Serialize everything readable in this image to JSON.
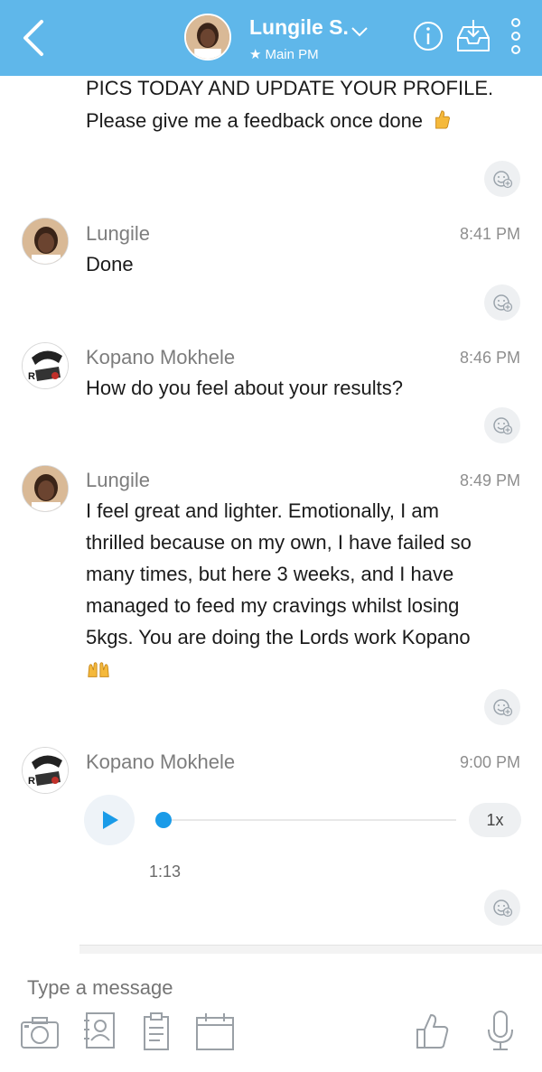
{
  "header": {
    "contact_name": "Lungile S.",
    "subtitle": "Main PM",
    "background_color": "#5fb7ea",
    "icons": [
      "back-arrow-icon",
      "chevron-down-icon",
      "info-icon",
      "inbox-download-icon",
      "more-vertical-icon"
    ]
  },
  "conversation": {
    "top_message_lines": [
      "PICS TODAY AND UPDATE YOUR PROFILE.",
      "Please give me a feedback once done"
    ],
    "messages": [
      {
        "sender": "Lungile",
        "time": "8:41 PM",
        "lines": [
          "Done"
        ]
      },
      {
        "sender": "Kopano Mokhele",
        "time": "8:46 PM",
        "lines": [
          "How do you feel about your results?"
        ]
      },
      {
        "sender": "Lungile",
        "time": "8:49 PM",
        "lines": [
          "I feel great and lighter. Emotionally, I am",
          "thrilled because on my own, I have failed so",
          "many times, but here 3 weeks, and I have",
          "managed to feed my cravings whilst losing",
          "5kgs. You are doing the Lords work Kopano"
        ]
      },
      {
        "sender": "Kopano Mokhele",
        "time": "9:00 PM",
        "voice": {
          "duration": "1:13",
          "speed": "1x",
          "progress": 0.0
        }
      }
    ]
  },
  "composer": {
    "placeholder": "Type a message",
    "icons": [
      "camera-icon",
      "contact-card-icon",
      "document-icon",
      "calendar-icon",
      "thumbs-up-icon",
      "microphone-icon"
    ]
  },
  "colors": {
    "accent_blue": "#1a9be8",
    "muted_text": "#7d7d7d"
  }
}
